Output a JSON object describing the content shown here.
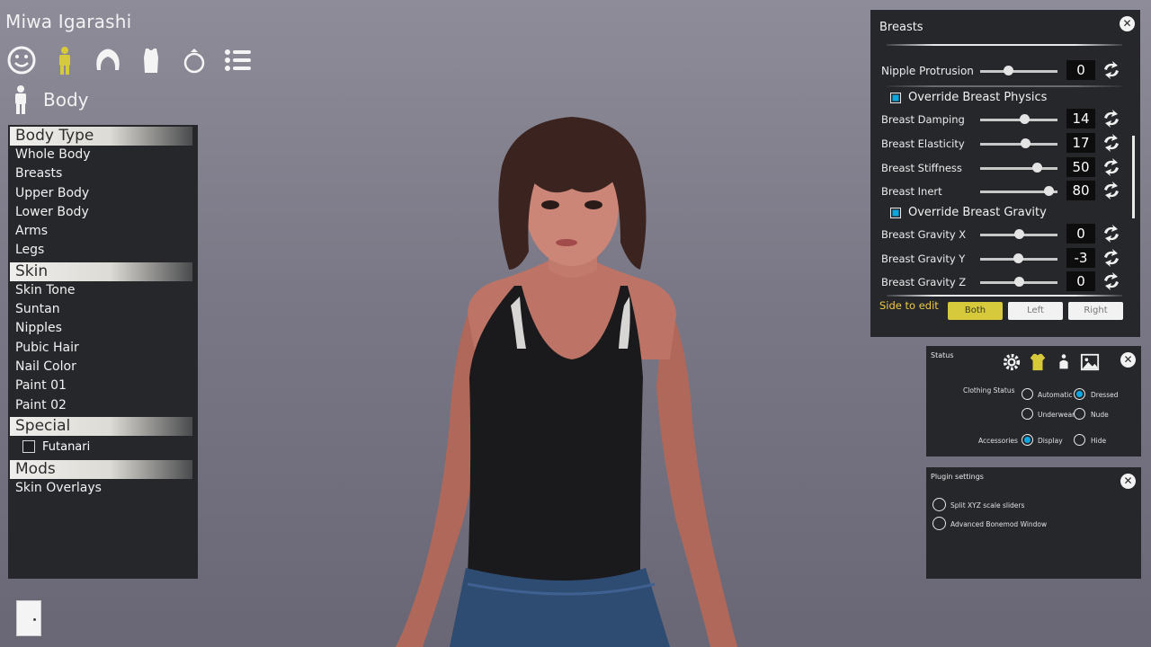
{
  "character": {
    "name": "Miwa Igarashi"
  },
  "categories": [
    {
      "name": "face",
      "icon": "face-icon",
      "active": false
    },
    {
      "name": "body",
      "icon": "body-icon",
      "active": true
    },
    {
      "name": "hair",
      "icon": "hair-icon",
      "active": false
    },
    {
      "name": "clothing",
      "icon": "clothing-icon",
      "active": false
    },
    {
      "name": "accessories",
      "icon": "ring-icon",
      "active": false
    },
    {
      "name": "extras",
      "icon": "list-icon",
      "active": false
    }
  ],
  "section": {
    "title": "Body",
    "icon": "body-icon"
  },
  "left_menu": {
    "body_type_header": "Body Type",
    "body_type_items": [
      "Whole Body",
      "Breasts",
      "Upper Body",
      "Lower Body",
      "Arms",
      "Legs"
    ],
    "skin_header": "Skin",
    "skin_items": [
      "Skin Tone",
      "Suntan",
      "Nipples",
      "Pubic Hair",
      "Nail Color",
      "Paint 01",
      "Paint 02"
    ],
    "special_header": "Special",
    "futanari_label": "Futanari",
    "futanari_checked": false,
    "mods_header": "Mods",
    "mods_items": [
      "Skin Overlays"
    ]
  },
  "breasts_panel": {
    "title": "Breasts",
    "close": "✕",
    "nipple_protrusion": {
      "label": "Nipple Protrusion",
      "value": "0",
      "fraction": 0.36
    },
    "override_physics_label": "Override Breast Physics",
    "override_physics_checked": true,
    "breast_damping": {
      "label": "Breast Damping",
      "value": "14",
      "fraction": 0.57
    },
    "breast_elasticity": {
      "label": "Breast Elasticity",
      "value": "17",
      "fraction": 0.58
    },
    "breast_stiffness": {
      "label": "Breast Stiffness",
      "value": "50",
      "fraction": 0.73
    },
    "breast_inert": {
      "label": "Breast Inert",
      "value": "80",
      "fraction": 0.88
    },
    "override_gravity_label": "Override Breast Gravity",
    "override_gravity_checked": true,
    "gravity_x": {
      "label": "Breast Gravity X",
      "value": "0",
      "fraction": 0.5
    },
    "gravity_y": {
      "label": "Breast Gravity Y",
      "value": "-3",
      "fraction": 0.49
    },
    "gravity_z": {
      "label": "Breast Gravity Z",
      "value": "0",
      "fraction": 0.5
    },
    "side_label": "Side to edit",
    "side_options": [
      "Both",
      "Left",
      "Right"
    ],
    "side_selected": "Both"
  },
  "status_panel": {
    "title": "Status",
    "close": "✕",
    "clothing_status_label": "Clothing Status",
    "clothing_options": [
      "Automatic",
      "Dressed",
      "Underwear",
      "Nude"
    ],
    "clothing_selected": "Dressed",
    "accessories_label": "Accessories",
    "accessories_options": [
      "Display",
      "Hide"
    ],
    "accessories_selected": "Display"
  },
  "plugin_panel": {
    "title": "Plugin settings",
    "close": "✕",
    "options": [
      "Split XYZ scale sliders",
      "Advanced Bonemod Window"
    ]
  },
  "colors": {
    "accent_active": "#d6c93b",
    "panel_bg": "#25272b",
    "checkbox_blue": "#0aa6e0",
    "side_label": "#f0c94b"
  }
}
